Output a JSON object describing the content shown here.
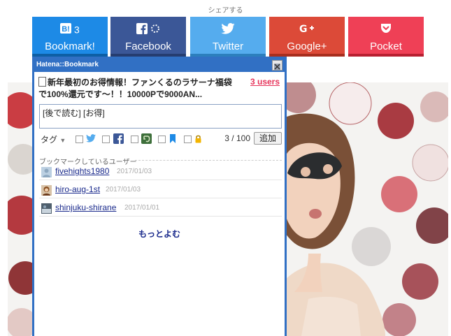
{
  "share": {
    "title": "シェアする",
    "buttons": [
      {
        "label": "Bookmark!",
        "count": "3",
        "icon": "hatena-b-icon",
        "color": "#1d8ae6"
      },
      {
        "label": "Facebook",
        "icon": "facebook-icon",
        "color": "#3b5797"
      },
      {
        "label": "Twitter",
        "icon": "twitter-bird-icon",
        "color": "#55acee"
      },
      {
        "label": "Google+",
        "icon": "google-plus-icon",
        "color": "#dc4a38"
      },
      {
        "label": "Pocket",
        "icon": "pocket-icon",
        "color": "#ef4056"
      }
    ]
  },
  "popup": {
    "header": "Hatena::Bookmark",
    "entry_title": "新年最初のお得情報！ファンくるのラサーナ福袋で100%還元です〜！！10000Pで9000AN...",
    "users_link": "3 users",
    "comment_value": "[後で読む] [お得]",
    "tag_label": "タグ",
    "char_count": "3 / 100",
    "add_label": "追加",
    "section_title": "ブックマークしているユーザー",
    "users": [
      {
        "name": "fivehights1980",
        "date": "2017/01/03"
      },
      {
        "name": "hiro-aug-1st",
        "date": "2017/01/03"
      },
      {
        "name": "shinjuku-shirane",
        "date": "2017/01/01"
      }
    ],
    "more_label": "もっとよむ"
  },
  "colors": {
    "popup_border": "#3170c4",
    "users_link": "#e6335a",
    "user_link": "#1a2a8c"
  }
}
